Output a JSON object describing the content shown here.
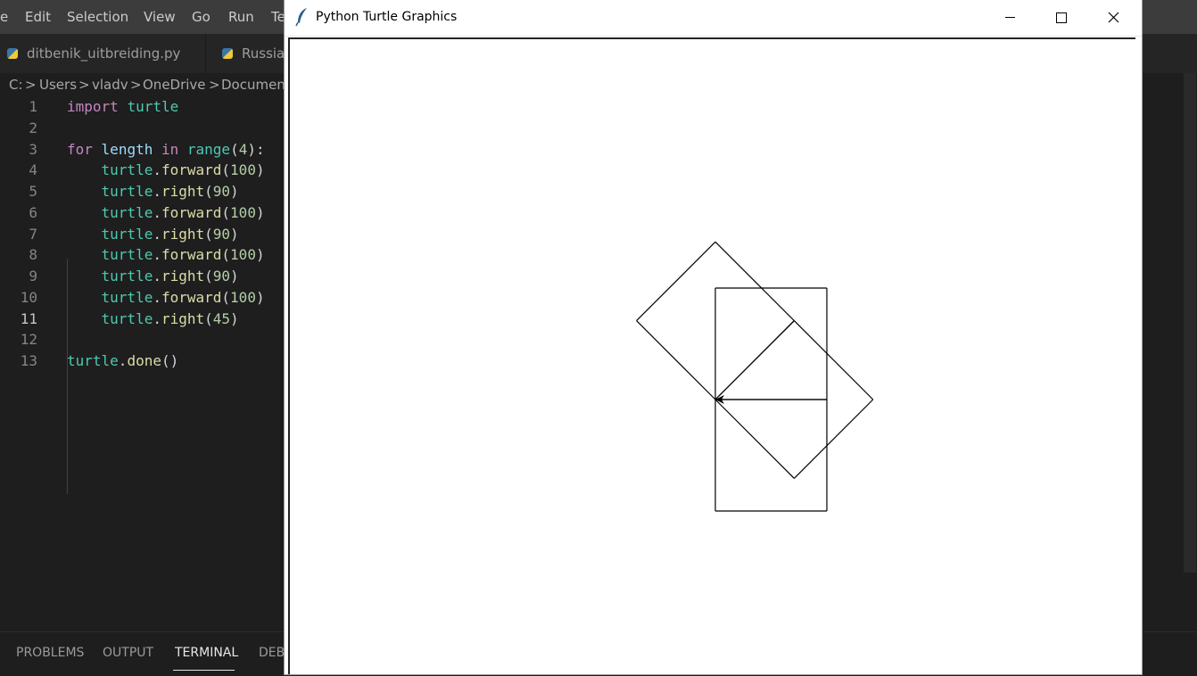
{
  "vscode": {
    "menu": [
      "e",
      "Edit",
      "Selection",
      "View",
      "Go",
      "Run",
      "Te"
    ],
    "tabs": [
      {
        "label": "ditbenik_uitbreiding.py",
        "icon": "python-file-icon"
      },
      {
        "label": "Russiar",
        "icon": "python-file-icon"
      }
    ],
    "breadcrumb": [
      "C:",
      "Users",
      "vladv",
      "OneDrive",
      "Document"
    ],
    "breadcrumb_separator": ">",
    "active_line": 11,
    "code_lines": [
      {
        "n": "1",
        "tokens": [
          {
            "t": "import",
            "c": "kw"
          },
          {
            "t": " "
          },
          {
            "t": "turtle",
            "c": "mod"
          }
        ]
      },
      {
        "n": "2",
        "tokens": []
      },
      {
        "n": "3",
        "tokens": [
          {
            "t": "for",
            "c": "kw"
          },
          {
            "t": " "
          },
          {
            "t": "length",
            "c": "var"
          },
          {
            "t": " "
          },
          {
            "t": "in",
            "c": "kw"
          },
          {
            "t": " "
          },
          {
            "t": "range",
            "c": "mod"
          },
          {
            "t": "("
          },
          {
            "t": "4",
            "c": "num"
          },
          {
            "t": "):"
          }
        ]
      },
      {
        "n": "4",
        "tokens": [
          {
            "t": "    "
          },
          {
            "t": "turtle",
            "c": "mod"
          },
          {
            "t": "."
          },
          {
            "t": "forward",
            "c": "fn"
          },
          {
            "t": "("
          },
          {
            "t": "100",
            "c": "num"
          },
          {
            "t": ")"
          }
        ]
      },
      {
        "n": "5",
        "tokens": [
          {
            "t": "    "
          },
          {
            "t": "turtle",
            "c": "mod"
          },
          {
            "t": "."
          },
          {
            "t": "right",
            "c": "fn"
          },
          {
            "t": "("
          },
          {
            "t": "90",
            "c": "num"
          },
          {
            "t": ")"
          }
        ]
      },
      {
        "n": "6",
        "tokens": [
          {
            "t": "    "
          },
          {
            "t": "turtle",
            "c": "mod"
          },
          {
            "t": "."
          },
          {
            "t": "forward",
            "c": "fn"
          },
          {
            "t": "("
          },
          {
            "t": "100",
            "c": "num"
          },
          {
            "t": ")"
          }
        ]
      },
      {
        "n": "7",
        "tokens": [
          {
            "t": "    "
          },
          {
            "t": "turtle",
            "c": "mod"
          },
          {
            "t": "."
          },
          {
            "t": "right",
            "c": "fn"
          },
          {
            "t": "("
          },
          {
            "t": "90",
            "c": "num"
          },
          {
            "t": ")"
          }
        ]
      },
      {
        "n": "8",
        "tokens": [
          {
            "t": "    "
          },
          {
            "t": "turtle",
            "c": "mod"
          },
          {
            "t": "."
          },
          {
            "t": "forward",
            "c": "fn"
          },
          {
            "t": "("
          },
          {
            "t": "100",
            "c": "num"
          },
          {
            "t": ")"
          }
        ]
      },
      {
        "n": "9",
        "tokens": [
          {
            "t": "    "
          },
          {
            "t": "turtle",
            "c": "mod"
          },
          {
            "t": "."
          },
          {
            "t": "right",
            "c": "fn"
          },
          {
            "t": "("
          },
          {
            "t": "90",
            "c": "num"
          },
          {
            "t": ")"
          }
        ]
      },
      {
        "n": "10",
        "tokens": [
          {
            "t": "    "
          },
          {
            "t": "turtle",
            "c": "mod"
          },
          {
            "t": "."
          },
          {
            "t": "forward",
            "c": "fn"
          },
          {
            "t": "("
          },
          {
            "t": "100",
            "c": "num"
          },
          {
            "t": ")"
          }
        ]
      },
      {
        "n": "11",
        "tokens": [
          {
            "t": "    "
          },
          {
            "t": "turtle",
            "c": "mod"
          },
          {
            "t": "."
          },
          {
            "t": "right",
            "c": "fn"
          },
          {
            "t": "("
          },
          {
            "t": "45",
            "c": "num"
          },
          {
            "t": ")"
          }
        ]
      },
      {
        "n": "12",
        "tokens": []
      },
      {
        "n": "13",
        "tokens": [
          {
            "t": "turtle",
            "c": "mod"
          },
          {
            "t": "."
          },
          {
            "t": "done",
            "c": "fn"
          },
          {
            "t": "()"
          }
        ]
      }
    ],
    "panel_tabs": [
      "PROBLEMS",
      "OUTPUT",
      "TERMINAL",
      "DEBU"
    ],
    "active_panel_tab": "TERMINAL"
  },
  "turtle_window": {
    "title": "Python Turtle Graphics",
    "icon": "feather-icon",
    "controls": [
      "minimize-icon",
      "maximize-icon",
      "close-icon"
    ],
    "drawing": {
      "step": 100,
      "turn_angle_deg": 90,
      "final_turn_deg": 45,
      "iterations": 4,
      "pen_color": "#000000",
      "turtle_shape": "arrow"
    }
  },
  "colors": {
    "keyword": "#c586c0",
    "module": "#4ec9b0",
    "variable": "#9cdcfe",
    "function": "#dcdcaa",
    "number": "#b5cea8",
    "editor_bg": "#1e1e1e",
    "menubar_bg": "#3c3c3c"
  }
}
